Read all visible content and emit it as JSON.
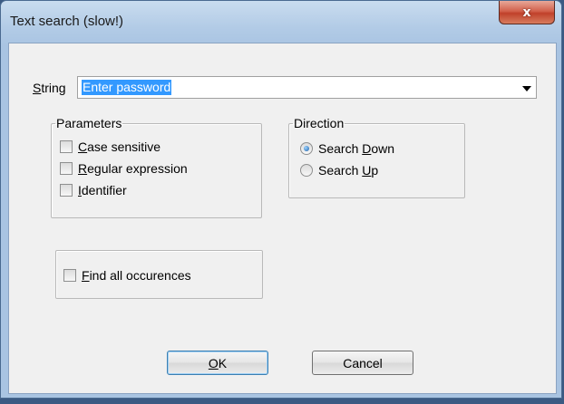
{
  "window": {
    "title": "Text search (slow!)",
    "close_symbol": "x"
  },
  "string_field": {
    "label_first": "S",
    "label_rest": "tring",
    "value": "Enter password"
  },
  "parameters": {
    "legend": "Parameters",
    "options": [
      {
        "accel": "C",
        "rest": "ase sensitive",
        "checked": false
      },
      {
        "accel": "R",
        "rest": "egular expression",
        "checked": false
      },
      {
        "accel": "I",
        "rest": "dentifier",
        "checked": false
      }
    ]
  },
  "direction": {
    "legend": "Direction",
    "options": [
      {
        "before": "Search ",
        "accel": "D",
        "rest": "own",
        "selected": true
      },
      {
        "before": "Search ",
        "accel": "U",
        "rest": "p",
        "selected": false
      }
    ]
  },
  "find_all": {
    "accel": "F",
    "rest": "ind all occurences",
    "checked": false
  },
  "buttons": {
    "ok": {
      "accel": "O",
      "rest": "K"
    },
    "cancel": "Cancel"
  },
  "colors": {
    "selection": "#3399ff",
    "close": "#c0412b",
    "client": "#f0f0f0"
  }
}
